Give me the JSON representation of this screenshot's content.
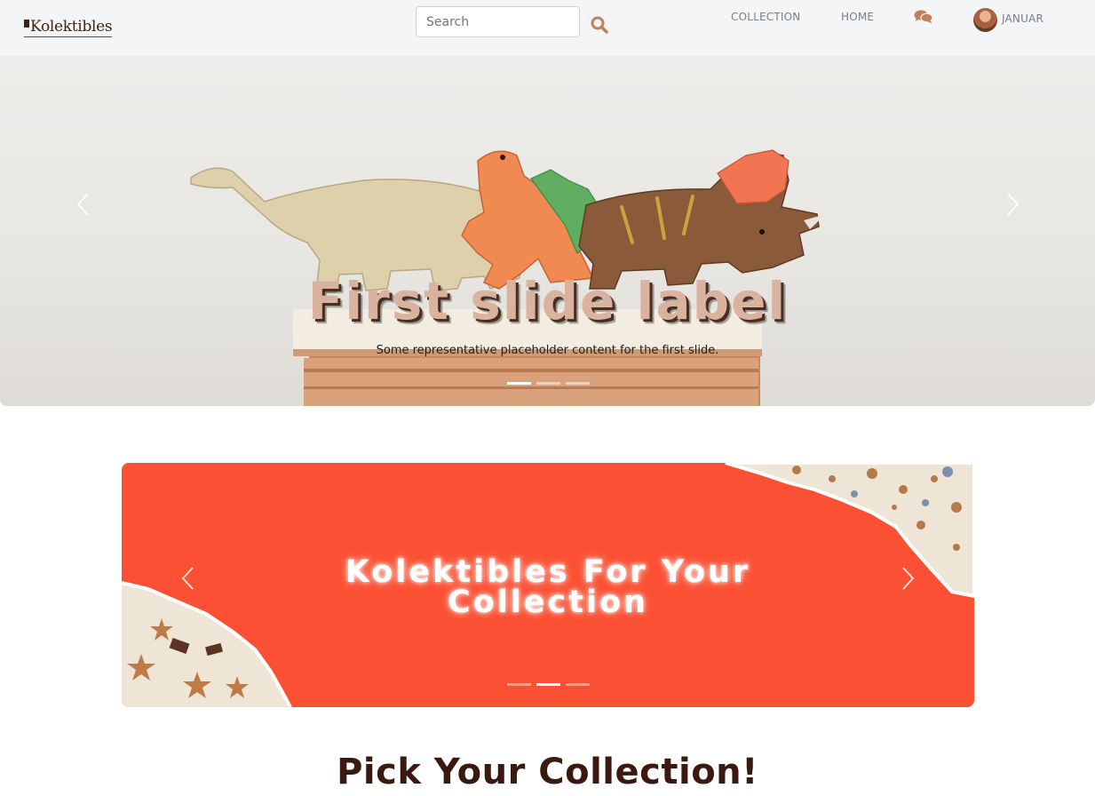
{
  "navbar": {
    "brand": "Kolektibles",
    "search_placeholder": "Search",
    "links": {
      "collection": "COLLECTION",
      "home": "HOME"
    },
    "user_name": "JANUAR",
    "icons": [
      "search-icon",
      "chat-icon",
      "avatar"
    ],
    "accent_color": "#c0825a"
  },
  "hero_carousel": {
    "slide_title": "First slide label",
    "slide_caption": "Some representative placeholder content for the first slide.",
    "slide_count": 3,
    "active_index": 0
  },
  "promo_carousel": {
    "title_line1": "Kolektibles For Your",
    "title_line2": "Collection",
    "slide_count": 3,
    "active_index": 1,
    "background_color": "#fb5033"
  },
  "section": {
    "heading": "Pick Your Collection!"
  }
}
